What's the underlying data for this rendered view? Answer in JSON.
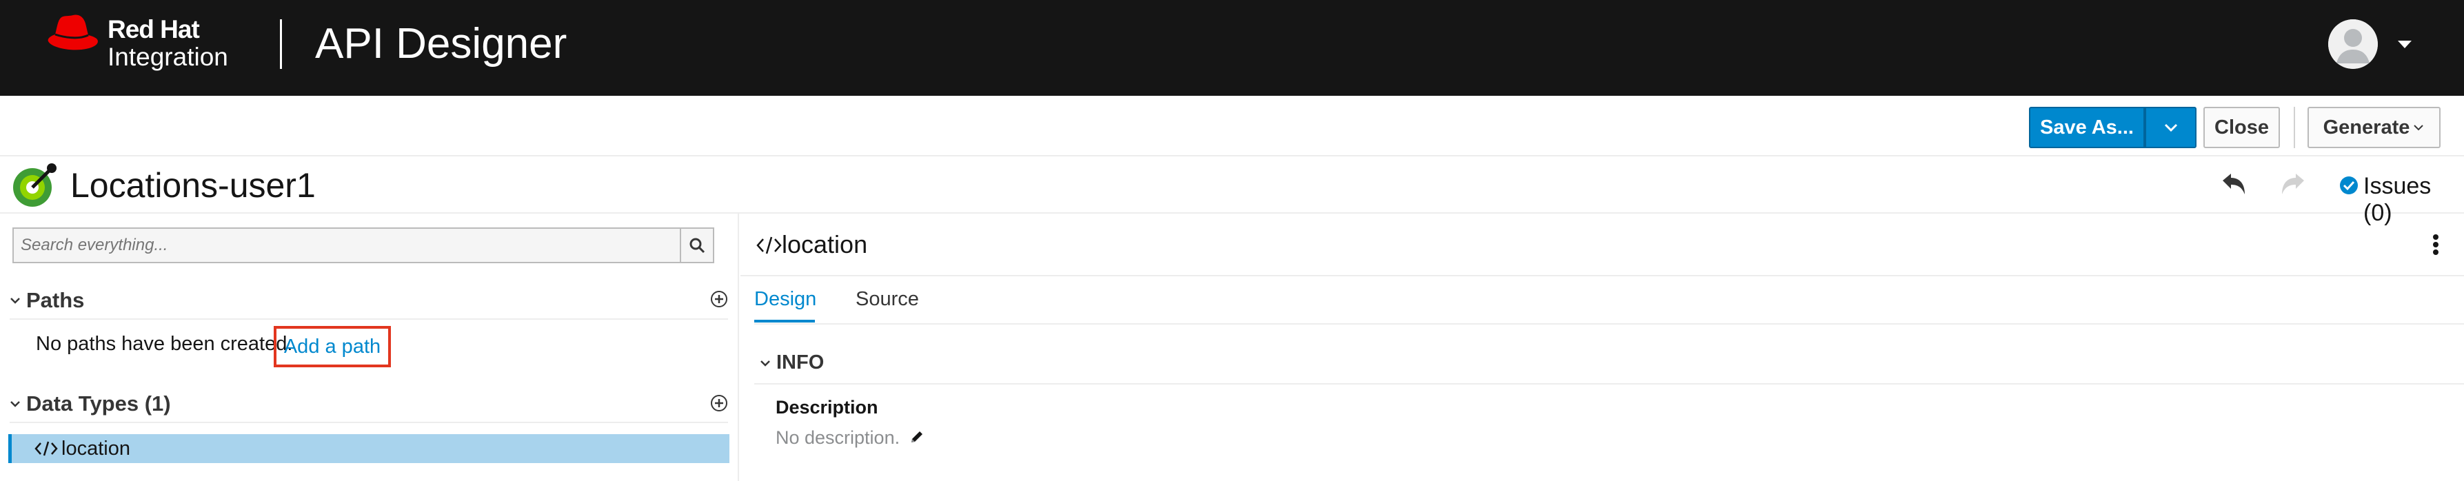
{
  "masthead": {
    "brand_line1": "Red Hat",
    "brand_line2": "Integration",
    "app_title": "API Designer",
    "brand_color": "#ee0000",
    "background": "#151515",
    "avatar_icon": "user-avatar-icon",
    "menu_icon": "caret-down-icon"
  },
  "toolbar": {
    "save_as_label": "Save As...",
    "close_label": "Close",
    "generate_label": "Generate",
    "primary_color": "#0088ce"
  },
  "title_bar": {
    "api_name": "Locations-user1",
    "issues_label": "Issues (0)"
  },
  "left_pane": {
    "search_placeholder": "Search everything...",
    "paths": {
      "title": "Paths",
      "empty_text": "No paths have been created.",
      "add_link": "Add a path"
    },
    "data_types": {
      "title": "Data Types (1)",
      "items": [
        {
          "label": "location",
          "selected": true
        }
      ]
    }
  },
  "right_pane": {
    "title": "location",
    "tabs": [
      {
        "label": "Design",
        "active": true
      },
      {
        "label": "Source",
        "active": false
      }
    ],
    "info": {
      "title": "INFO",
      "description_label": "Description",
      "description_value": "No description."
    }
  }
}
